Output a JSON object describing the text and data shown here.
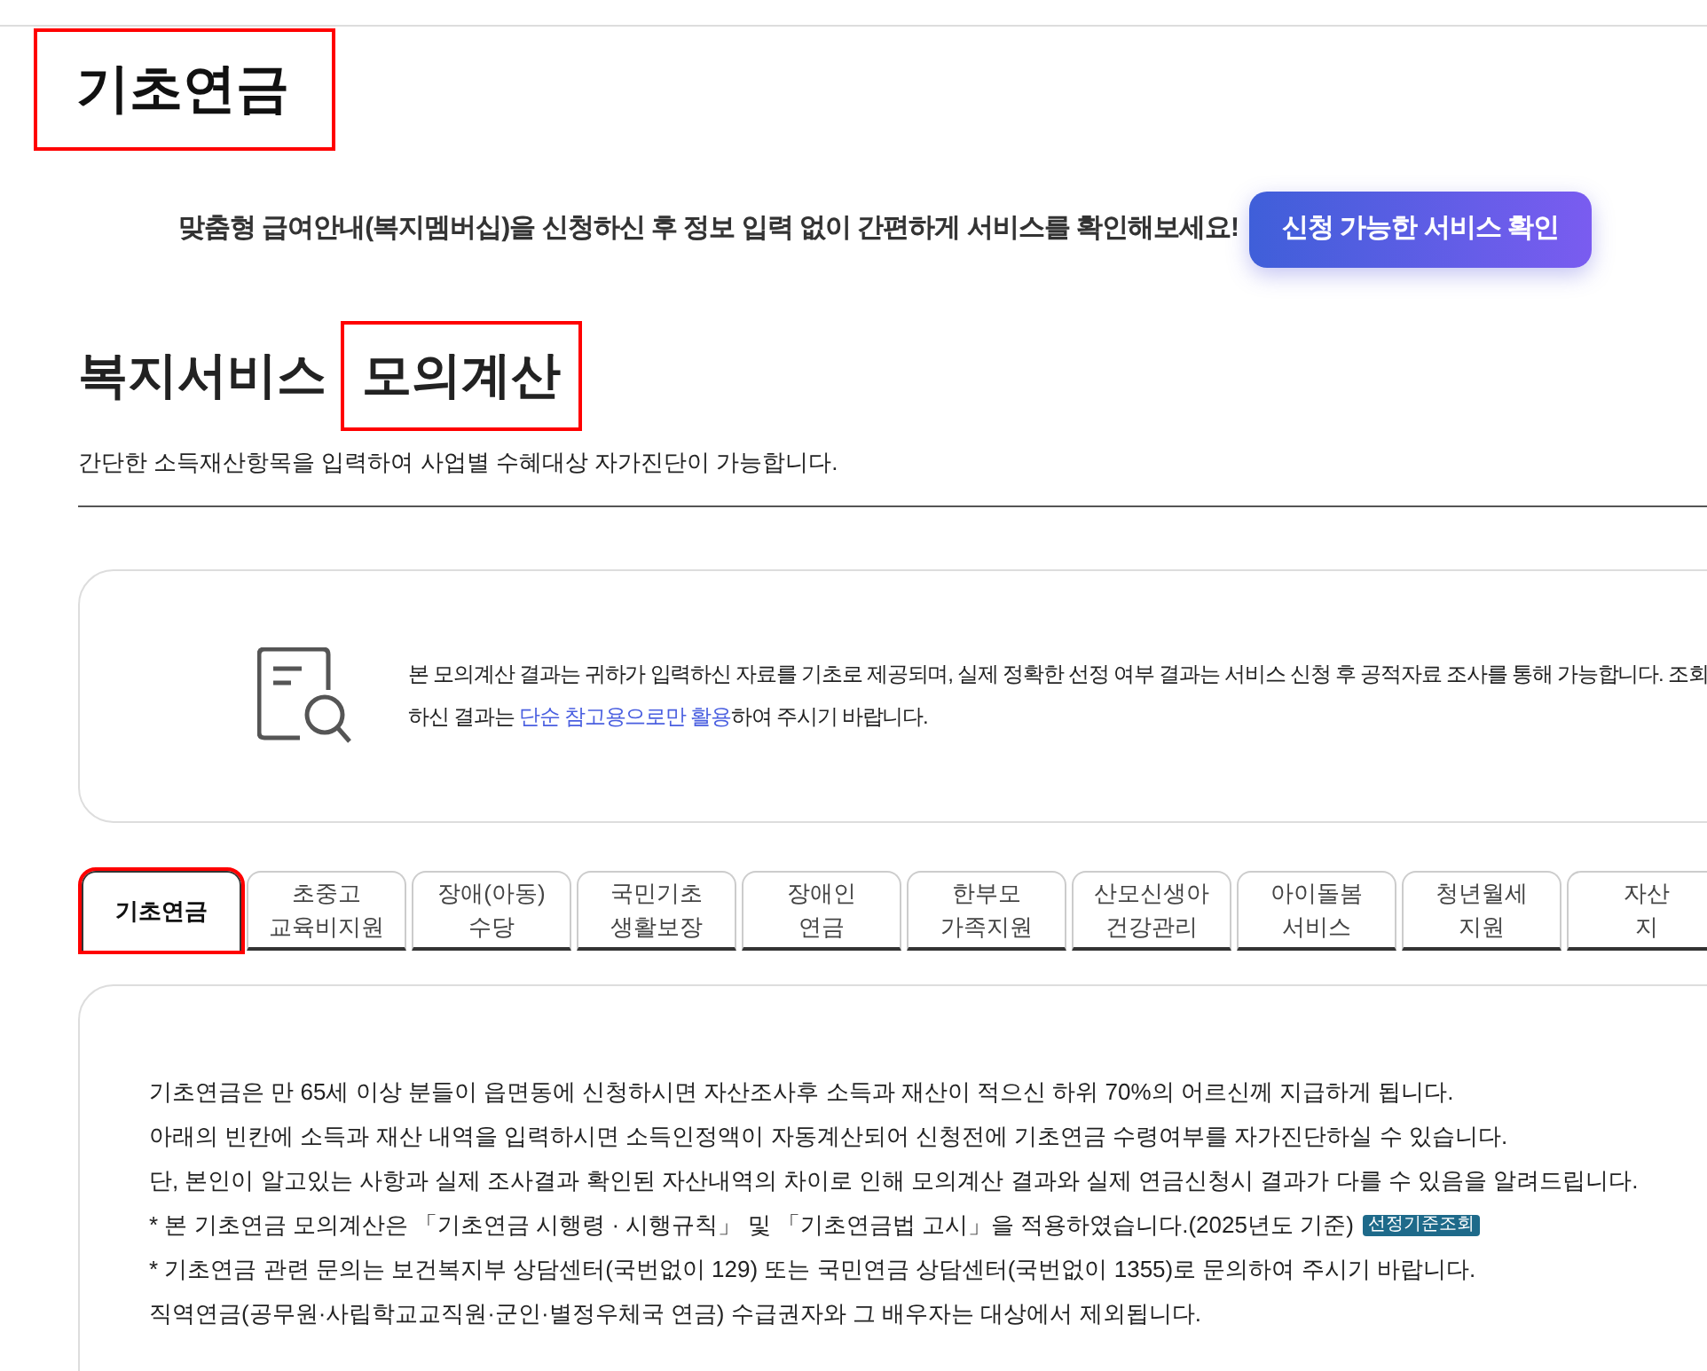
{
  "page_title": {
    "text": "기초연금",
    "highlighted": true
  },
  "banner": {
    "text": "맞춤형 급여안내(복지멤버십)을 신청하신 후 정보 입력 없이 간편하게 서비스를 확인해보세요!",
    "button": "신청 가능한 서비스 확인"
  },
  "section": {
    "title": [
      {
        "text": "복지서비스",
        "highlighted": false
      },
      {
        "text": "모의계산",
        "highlighted": true
      }
    ],
    "description": "간단한 소득재산항목을 입력하여 사업별 수혜대상 자가진단이 가능합니다."
  },
  "notice": {
    "lines": [
      "본 모의계산 결과는 귀하가 입력하신 자료를 기초로 제공되며, 실제 정확한 선정 여부 결과는 서비스 신청 후 공적자료 조사를 통해 가능합니다. 조회"
    ],
    "last_line_before": "하신 결과는 ",
    "link": "단순 참고용으로만 활용",
    "last_line_after": "하여 주시기 바랍니다."
  },
  "tabs": [
    {
      "lines": [
        "기초연금"
      ],
      "selected": true,
      "highlighted": true
    },
    {
      "lines": [
        "초중고",
        "교육비지원"
      ],
      "selected": false,
      "highlighted": false
    },
    {
      "lines": [
        "장애(아동)",
        "수당"
      ],
      "selected": false,
      "highlighted": false
    },
    {
      "lines": [
        "국민기초",
        "생활보장"
      ],
      "selected": false,
      "highlighted": false
    },
    {
      "lines": [
        "장애인",
        "연금"
      ],
      "selected": false,
      "highlighted": false
    },
    {
      "lines": [
        "한부모",
        "가족지원"
      ],
      "selected": false,
      "highlighted": false
    },
    {
      "lines": [
        "산모신생아",
        "건강관리"
      ],
      "selected": false,
      "highlighted": false
    },
    {
      "lines": [
        "아이돌봄",
        "서비스"
      ],
      "selected": false,
      "highlighted": false
    },
    {
      "lines": [
        "청년월세",
        "지원"
      ],
      "selected": false,
      "highlighted": false
    },
    {
      "lines": [
        "자산",
        "지"
      ],
      "selected": false,
      "highlighted": false
    }
  ],
  "content": {
    "paragraphs": [
      {
        "text": "기초연금은 만 65세 이상 분들이 읍면동에 신청하시면 자산조사후 소득과 재산이 적으신 하위 70%의 어르신께 지급하게 됩니다."
      },
      {
        "text": "아래의 빈칸에 소득과 재산 내역을 입력하시면 소득인정액이 자동계산되어 신청전에 기초연금 수령여부를 자가진단하실 수 있습니다."
      },
      {
        "text": "단, 본인이 알고있는 사항과 실제 조사결과 확인된 자산내역의 차이로 인해 모의계산 결과와 실제 연금신청시 결과가 다를 수 있음을 알려드립니다."
      },
      {
        "text": "* 본 기초연금 모의계산은 「기초연금 시행령 · 시행규칙」 및 「기초연금법 고시」을 적용하였습니다.(2025년도 기준)",
        "badge": "선정기준조회"
      },
      {
        "text": "* 기초연금 관련 문의는 보건복지부 상담센터(국번없이 129) 또는 국민연금 상담센터(국번없이 1355)로 문의하여 주시기 바랍니다."
      },
      {
        "text": "직역연금(공무원·사립학교교직원·군인·별정우체국 연금) 수급권자와 그 배우자는 대상에서 제외됩니다."
      }
    ]
  }
}
